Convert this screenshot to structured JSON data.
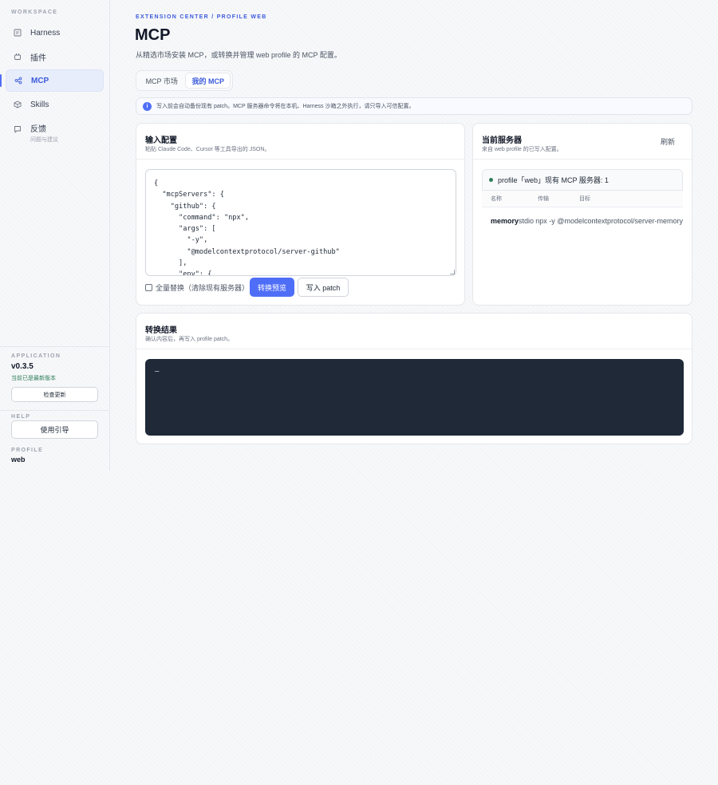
{
  "sidebar": {
    "workspace_heading": "WORKSPACE",
    "items": [
      {
        "label": "Harness",
        "icon": "document-icon"
      },
      {
        "label": "插件",
        "icon": "plugin-icon"
      },
      {
        "label": "MCP",
        "icon": "share-icon"
      },
      {
        "label": "Skills",
        "icon": "cube-icon"
      },
      {
        "label": "反馈",
        "sub": "问题与建议",
        "icon": "chat-icon"
      }
    ],
    "active": "MCP",
    "application_heading": "APPLICATION",
    "version": "v0.3.5",
    "version_status": "当前已是最新版本",
    "check_update_label": "检查更新",
    "help_heading": "HELP",
    "guide_label": "使用引导",
    "profile_heading": "PROFILE",
    "profile_value": "web"
  },
  "header": {
    "eyebrow": "EXTENSION CENTER / PROFILE WEB",
    "title": "MCP",
    "description": "从精选市场安装 MCP，或转换并管理 web profile 的 MCP 配置。"
  },
  "tabs": [
    {
      "label": "MCP 市场",
      "selected": false
    },
    {
      "label": "我的 MCP",
      "selected": true
    }
  ],
  "notice": {
    "icon": "i",
    "text": "写入前会自动备份现有 patch。MCP 服务器命令将在本机、Harness 沙箱之外执行，请只导入可信配置。"
  },
  "input_card": {
    "title": "输入配置",
    "subtitle": "粘贴 Claude Code、Cursor 等工具导出的 JSON。",
    "code": "{\n  \"mcpServers\": {\n    \"github\": {\n      \"command\": \"npx\",\n      \"args\": [\n        \"-y\",\n        \"@modelcontextprotocol/server-github\"\n      ],\n      \"env\": {",
    "replace_all_label": "全量替换（清除现有服务器）",
    "preview_button": "转换预览",
    "write_button": "写入 patch"
  },
  "servers_card": {
    "title": "当前服务器",
    "subtitle": "来自 web profile 的已写入配置。",
    "refresh_label": "刷新",
    "status_text": "profile「web」现有 MCP 服务器: 1",
    "columns": [
      "名称",
      "传输",
      "目标"
    ],
    "rows": [
      [
        "memory",
        "stdio",
        "npx -y @modelcontextprotocol/server-memory"
      ]
    ]
  },
  "result_card": {
    "title": "转换结果",
    "subtitle": "确认内容后，再写入 profile patch。",
    "output": "—"
  },
  "colors": {
    "accent": "#4f6ef7",
    "accent_text": "#3b5bdb",
    "success": "#2f7d5b",
    "dark_panel": "#1f2937"
  }
}
